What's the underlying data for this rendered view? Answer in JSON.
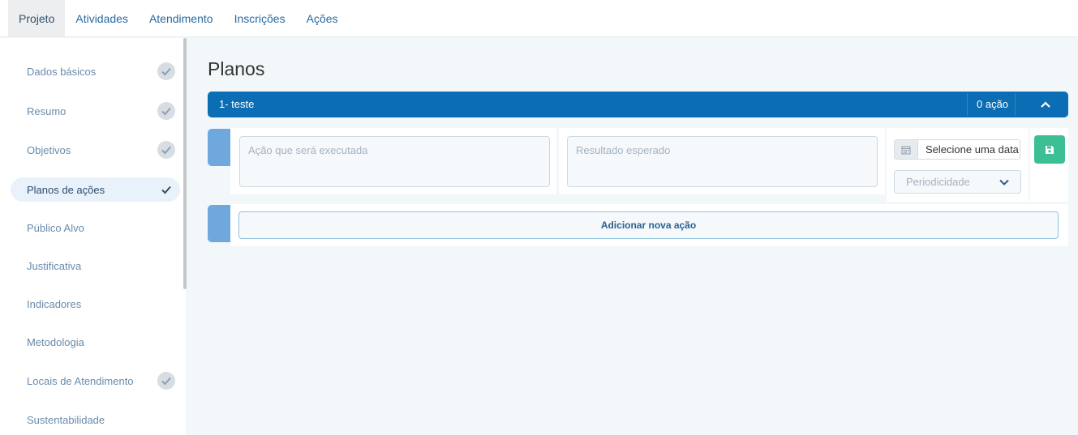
{
  "topnav": {
    "tabs": [
      {
        "label": "Projeto",
        "active": true
      },
      {
        "label": "Atividades"
      },
      {
        "label": "Atendimento"
      },
      {
        "label": "Inscrições"
      },
      {
        "label": "Ações"
      }
    ]
  },
  "sidebar": {
    "items": [
      {
        "label": "Dados básicos",
        "checked": true
      },
      {
        "label": "Resumo",
        "checked": true
      },
      {
        "label": "Objetivos",
        "checked": true
      },
      {
        "label": "Planos de ações",
        "checked": true,
        "active": true
      },
      {
        "label": "Público Alvo",
        "checked": false
      },
      {
        "label": "Justificativa",
        "checked": false
      },
      {
        "label": "Indicadores",
        "checked": false
      },
      {
        "label": "Metodologia",
        "checked": false
      },
      {
        "label": "Locais de Atendimento",
        "checked": true
      },
      {
        "label": "Sustentabilidade",
        "checked": false
      }
    ]
  },
  "main": {
    "title": "Planos",
    "plan": {
      "name": "1- teste",
      "count_label": "0 ação"
    },
    "action_row": {
      "action_placeholder": "Ação que será executada",
      "result_placeholder": "Resultado esperado",
      "date_label": "Selecione uma data",
      "periodicity_placeholder": "Periodicidade"
    },
    "add_action_label": "Adicionar nova ação"
  },
  "colors": {
    "primary": "#0b6db3",
    "accent_light": "#6fa8dc",
    "save_green": "#3cbf94",
    "background": "#f2f7fa"
  }
}
